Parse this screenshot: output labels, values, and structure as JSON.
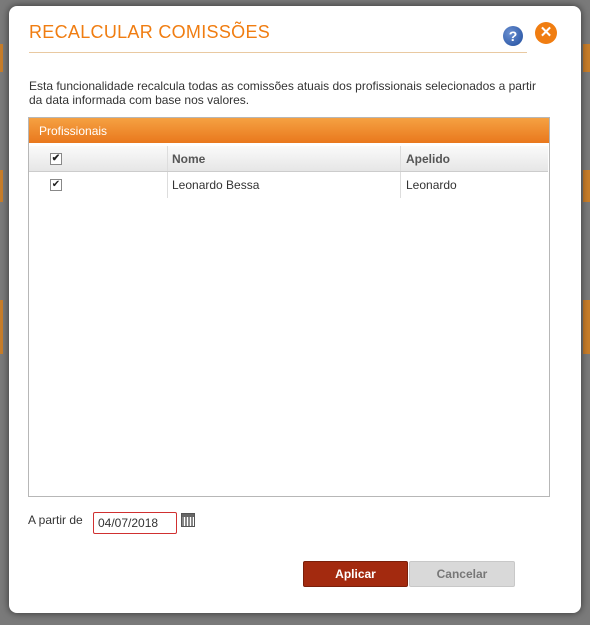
{
  "dialog": {
    "title": "RECALCULAR COMISSÕES",
    "help_icon": "question-icon",
    "close_icon": "close-icon",
    "description": "Esta funcionalidade recalcula todas as comissões atuais dos profissionais selecionados a partir da data informada com base nos valores."
  },
  "grid": {
    "title": "Profissionais",
    "columns": [
      "Nome",
      "Apelido"
    ],
    "rows": [
      {
        "checked": true,
        "nome": "Leonardo Bessa",
        "apelido": "Leonardo"
      }
    ]
  },
  "date": {
    "label": "A partir de",
    "value": "04/07/2018",
    "icon": "calendar-icon"
  },
  "buttons": {
    "apply": "Aplicar",
    "cancel": "Cancelar"
  },
  "colors": {
    "accent": "#f07d11",
    "apply": "#a32a0f",
    "cancel": "#d9d9d9"
  }
}
